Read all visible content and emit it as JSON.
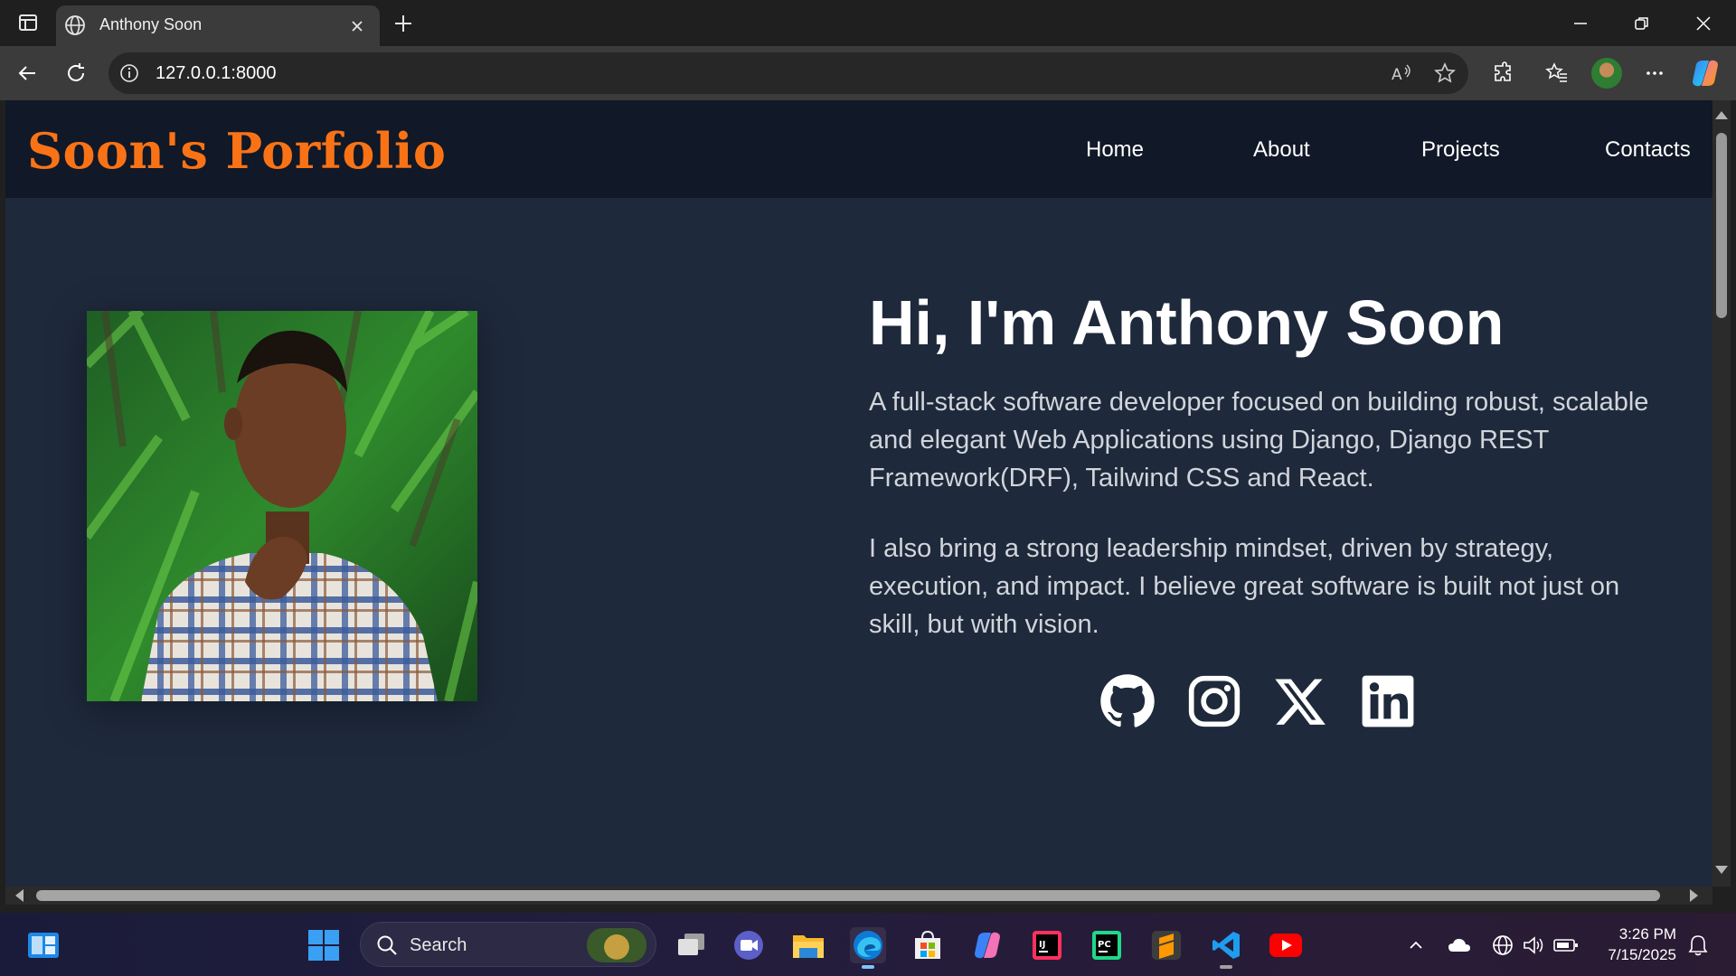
{
  "browser": {
    "tab_title": "Anthony Soon",
    "url": "127.0.0.1:8000"
  },
  "site": {
    "brand": "Soon's Porfolio",
    "nav": [
      "Home",
      "About",
      "Projects",
      "Contacts"
    ],
    "hero": {
      "title": "Hi, I'm Anthony Soon",
      "para1": "A full-stack software developer focused on building robust, scalable and elegant Web Applications using Django, Django REST Framework(DRF), Tailwind CSS and React.",
      "para2": "I also bring a strong leadership mindset, driven by strategy, execution, and impact. I believe great software is built not just on skill, but with vision."
    },
    "socials": [
      "github-icon",
      "instagram-icon",
      "x-icon",
      "linkedin-icon"
    ],
    "colors": {
      "nav_bg": "#111827",
      "page_bg": "#1e293b",
      "brand": "#f97316"
    }
  },
  "taskbar": {
    "search_label": "Search",
    "time": "3:26 PM",
    "date": "7/15/2025"
  }
}
